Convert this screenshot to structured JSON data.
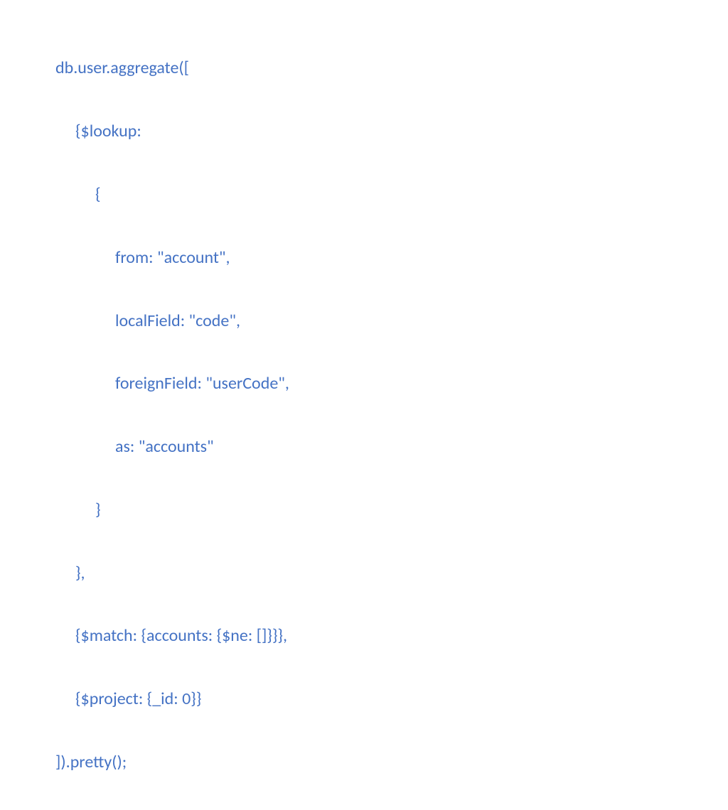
{
  "code": {
    "line1": "db.user.aggregate([",
    "line2": "{$lookup:",
    "line3": "{",
    "line4": "from: \"account\",",
    "line5": "localField: \"code\",",
    "line6": "foreignField: \"userCode\",",
    "line7": "as: \"accounts\"",
    "line8": "}",
    "line9": "},",
    "line10": "{$match: {accounts: {$ne: []}}},",
    "line11": "{$project: {_id: 0}}",
    "line12": "]).pretty();"
  }
}
